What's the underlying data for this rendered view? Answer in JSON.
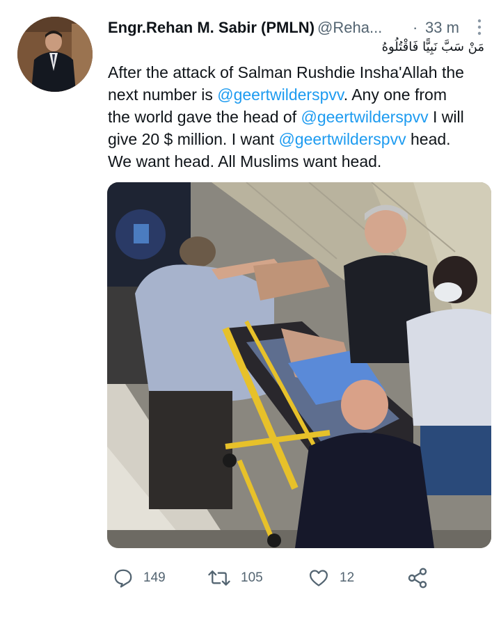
{
  "tweet": {
    "display_name": "Engr.Rehan M. Sabir (PMLN)",
    "handle": "@Reha...",
    "separator": "·",
    "timestamp": "33 m",
    "arabic_text": "مَنْ سَبَّ نَبِيًّا فَاقْتُلُوهُ",
    "text_lines": [
      [
        "After the attack of Salman Rushdie Insha'Allah the",
        "",
        ""
      ],
      [
        "next number is ",
        "@geertwilderspvv",
        ". Any one from"
      ],
      [
        "the world gave the head of ",
        "@geertwilderspvv",
        " I will"
      ],
      [
        "give 20 $ million. I want ",
        "@geertwilderspvv",
        " head."
      ],
      [
        "We want head. All Muslims want head.",
        "",
        ""
      ]
    ]
  },
  "actions": {
    "reply_count": "149",
    "retweet_count": "105",
    "like_count": "12"
  },
  "icons": {
    "avatar": "profile-photo",
    "more": "vertical-ellipsis-icon",
    "reply": "speech-bubble-icon",
    "retweet": "retweet-arrows-icon",
    "like": "heart-icon",
    "share": "share-nodes-icon"
  },
  "colors": {
    "text": "#0f1419",
    "secondary": "#536471",
    "mention": "#1d9bf0"
  }
}
